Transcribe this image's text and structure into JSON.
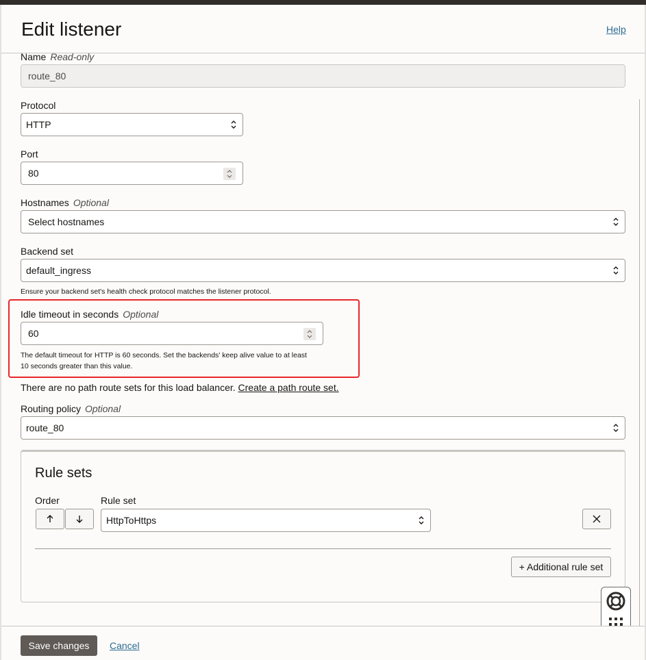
{
  "header": {
    "title": "Edit listener",
    "help_label": "Help"
  },
  "name": {
    "label": "Name",
    "qualifier": "Read-only",
    "value": "route_80"
  },
  "protocol": {
    "label": "Protocol",
    "value": "HTTP"
  },
  "port": {
    "label": "Port",
    "value": "80"
  },
  "hostnames": {
    "label": "Hostnames",
    "qualifier": "Optional",
    "placeholder": "Select hostnames"
  },
  "backend_set": {
    "label": "Backend set",
    "value": "default_ingress",
    "hint": "Ensure your backend set's health check protocol matches the listener protocol."
  },
  "idle_timeout": {
    "label": "Idle timeout in seconds",
    "qualifier": "Optional",
    "value": "60",
    "hint_line1": "The default timeout for HTTP is 60 seconds. Set the backends' keep alive value to at least",
    "hint_line2": "10 seconds greater than this value."
  },
  "path_route": {
    "text": "There are no path route sets for this load balancer.",
    "link": "Create a path route set."
  },
  "routing_policy": {
    "label": "Routing policy",
    "qualifier": "Optional",
    "value": "route_80"
  },
  "rule_sets": {
    "title": "Rule sets",
    "order_label": "Order",
    "rule_set_label": "Rule set",
    "up_icon": "arrow-up-icon",
    "down_icon": "arrow-down-icon",
    "rule_set_value": "HttpToHttps",
    "remove_icon": "close-icon",
    "add_label": "+ Additional rule set"
  },
  "footer": {
    "save_label": "Save changes",
    "cancel_label": "Cancel"
  },
  "help_widget": {
    "lifebuoy_icon": "lifebuoy-icon",
    "grid_icon": "grid-icon"
  },
  "colors": {
    "highlight": "#e8262b",
    "link": "#2b6b8f",
    "primary_button": "#5f5a55"
  }
}
